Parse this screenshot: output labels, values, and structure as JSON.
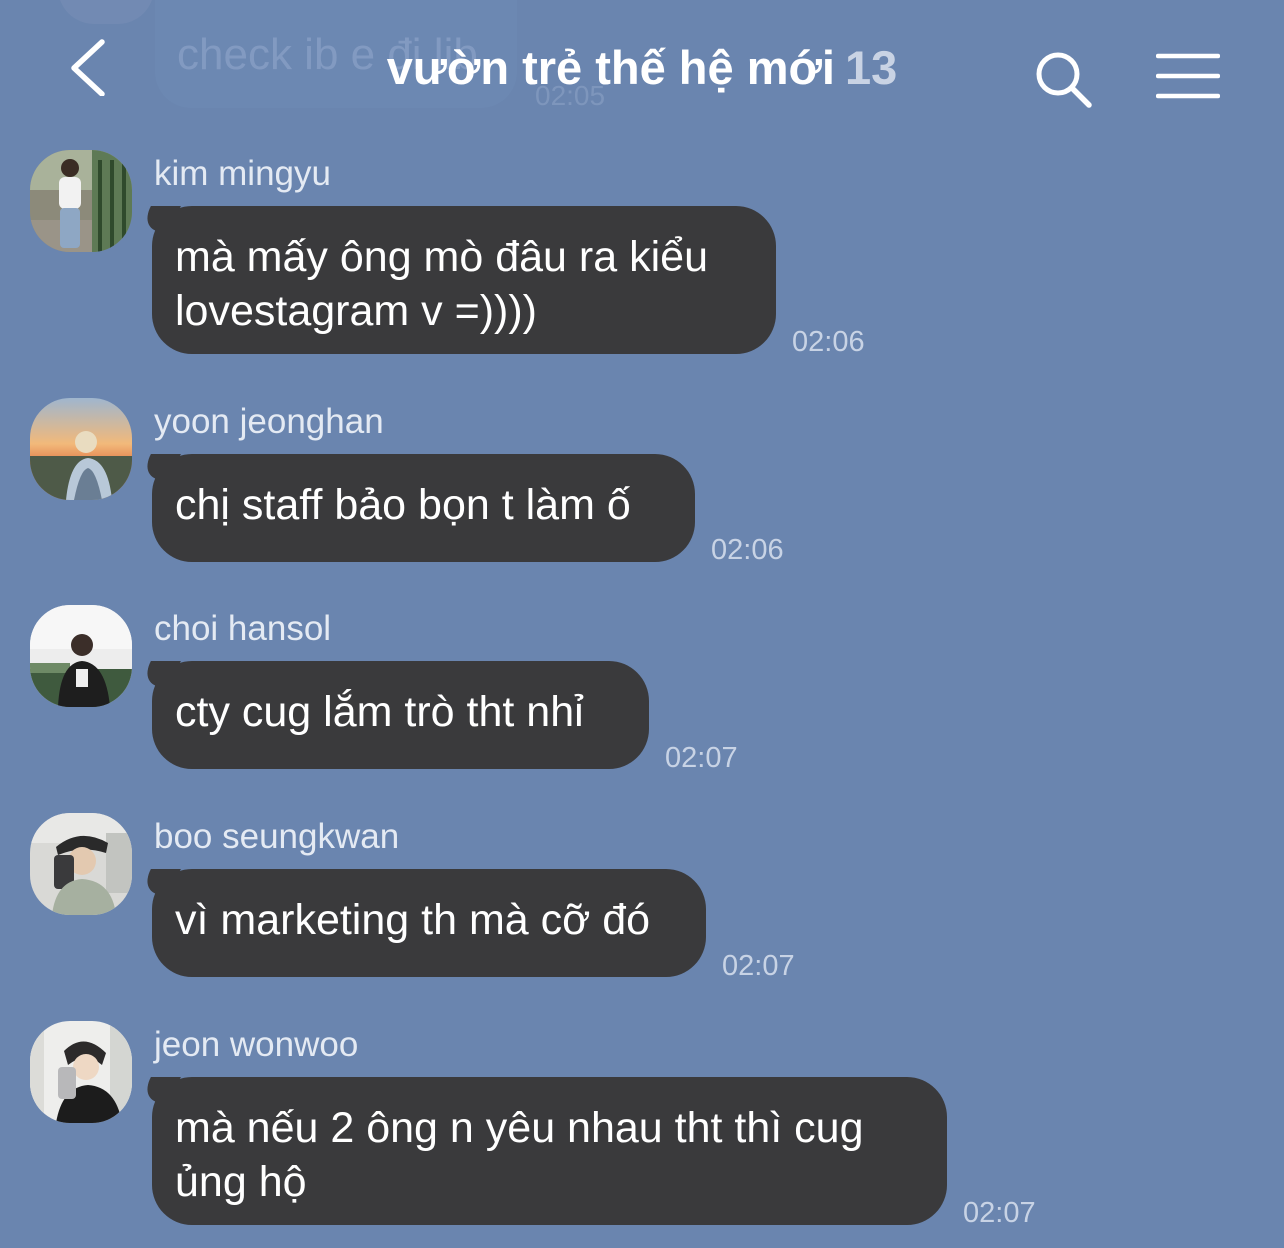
{
  "previous_message": {
    "text": "check ib e đi lib",
    "time": "02:05"
  },
  "header": {
    "title": "vườn trẻ thế hệ mới",
    "member_count": "13",
    "back_icon": "chevron-left-icon",
    "search_icon": "search-icon",
    "menu_icon": "hamburger-menu-icon"
  },
  "colors": {
    "background": "#6A85AF",
    "bubble": "#3A3A3C",
    "title": "#FFFFFF",
    "sender_name": "#E4EAF3",
    "timestamp": "#C8D3E5"
  },
  "messages": [
    {
      "sender": "kim mingyu",
      "lines": [
        "mà mấy ông mò đâu ra kiểu",
        "lovestagram v =))))"
      ],
      "time": "02:06"
    },
    {
      "sender": "yoon jeonghan",
      "lines": [
        "chị staff bảo bọn t làm ố"
      ],
      "time": "02:06"
    },
    {
      "sender": "choi hansol",
      "lines": [
        "cty cug lắm trò tht nhỉ"
      ],
      "time": "02:07"
    },
    {
      "sender": "boo seungkwan",
      "lines": [
        "vì marketing th mà cỡ đó"
      ],
      "time": "02:07"
    },
    {
      "sender": "jeon wonwoo",
      "lines": [
        "mà nếu 2 ông n yêu nhau tht thì cug",
        "ủng hộ"
      ],
      "time": "02:07"
    }
  ]
}
